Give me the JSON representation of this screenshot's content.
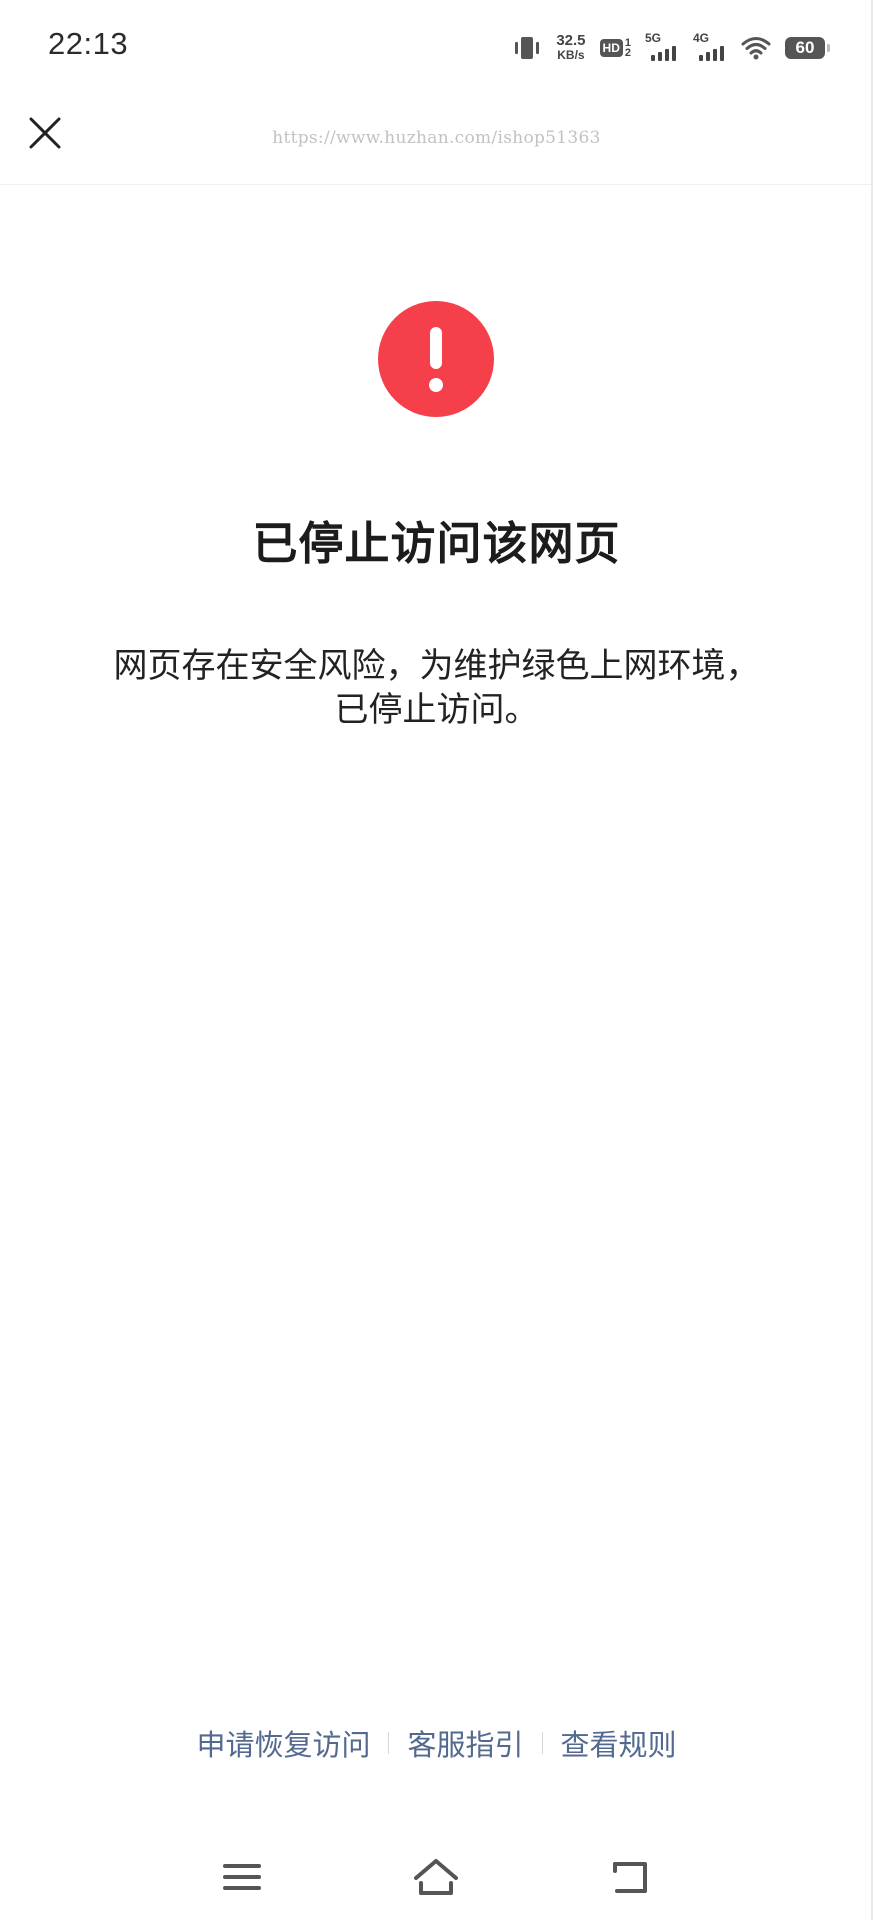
{
  "status_bar": {
    "time": "22:13",
    "net_speed_value": "32.5",
    "net_speed_unit": "KB/s",
    "hd_label": "HD",
    "hd_sub_top": "1",
    "hd_sub_bottom": "2",
    "sim1_label": "5G",
    "sim2_label": "4G",
    "battery_level": "60",
    "icons": [
      "vibrate-icon",
      "hd-icon",
      "signal-5g-icon",
      "signal-4g-icon",
      "wifi-icon",
      "battery-icon"
    ]
  },
  "nav_bar": {
    "close_icon": "close-icon",
    "url": "https://www.huzhan.com/ishop51363"
  },
  "main": {
    "alert_icon": "exclamation-icon",
    "alert_color": "#f5404c",
    "title": "已停止访问该网页",
    "description_line1": "网页存在安全风险，为维护绿色上网环境，",
    "description_line2": "已停止访问。"
  },
  "footer": {
    "links": [
      "申请恢复访问",
      "客服指引",
      "查看规则"
    ],
    "link_color": "#53698f"
  },
  "system_nav": {
    "icons": [
      "menu-icon",
      "home-icon",
      "back-icon"
    ]
  }
}
